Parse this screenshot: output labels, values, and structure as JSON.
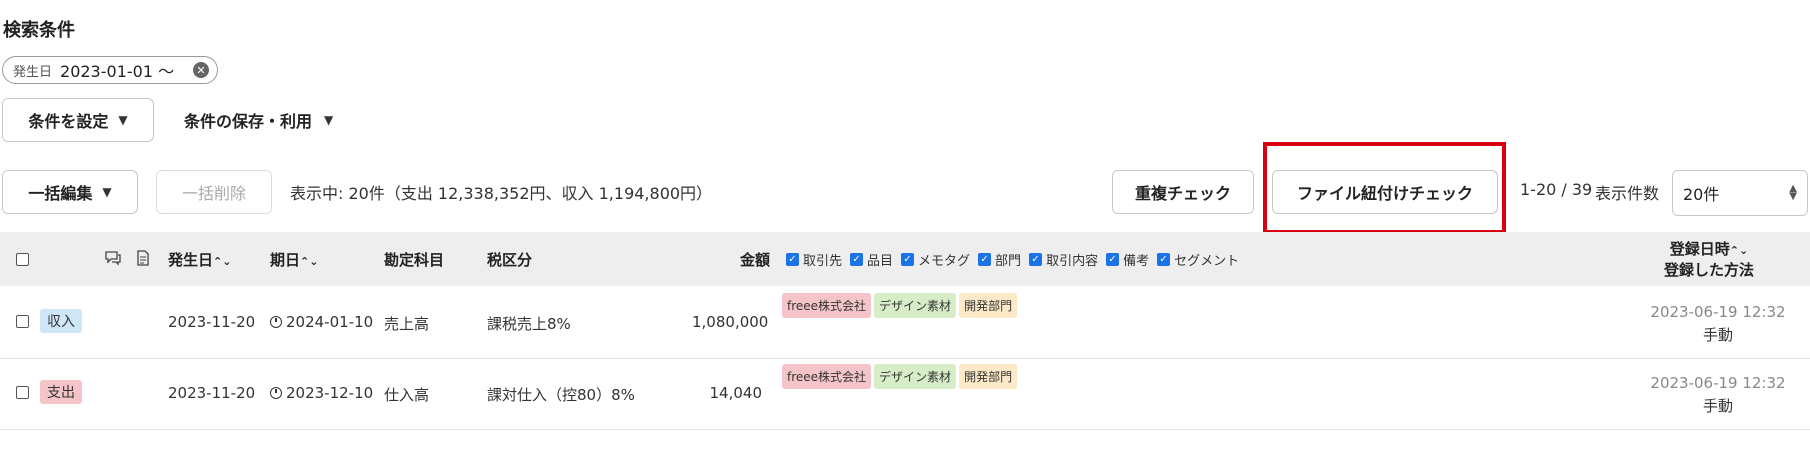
{
  "search": {
    "title": "検索条件",
    "filter_chip": {
      "label": "発生日",
      "value": "2023-01-01 〜"
    }
  },
  "controls": {
    "set_conditions": "条件を設定",
    "save_conditions": "条件の保存・利用"
  },
  "toolbar": {
    "bulk_edit": "一括編集",
    "bulk_delete": "一括削除",
    "summary": "表示中: 20件（支出 12,338,352円、収入 1,194,800円）",
    "duplicate_check": "重複チェック",
    "file_link_check": "ファイル紐付けチェック",
    "range": "1-20 / 39",
    "per_page_label": "表示件数",
    "per_page_value": "20件"
  },
  "table": {
    "headers": {
      "date": "発生日",
      "due": "期日",
      "account": "勘定科目",
      "tax": "税区分",
      "amount": "金額",
      "registered_line1": "登録日時",
      "registered_line2": "登録した方法"
    },
    "column_toggles": [
      "取引先",
      "品目",
      "メモタグ",
      "部門",
      "取引内容",
      "備考",
      "セグメント"
    ],
    "rows": [
      {
        "type": "収入",
        "date": "2023-11-20",
        "due": "2024-01-10",
        "account": "売上高",
        "tax": "課税売上8%",
        "amount": "1,080,000",
        "tags": [
          "freee株式会社",
          "デザイン素材",
          "開発部門"
        ],
        "registered_at": "2023-06-19 12:32",
        "method": "手動"
      },
      {
        "type": "支出",
        "date": "2023-11-20",
        "due": "2023-12-10",
        "account": "仕入高",
        "tax": "課対仕入（控80）8%",
        "amount": "14,040",
        "tags": [
          "freee株式会社",
          "デザイン素材",
          "開発部門"
        ],
        "registered_at": "2023-06-19 12:32",
        "method": "手動"
      }
    ]
  },
  "colors": {
    "highlight": "#d9000f",
    "income_badge": "#cfe6f6",
    "expense_badge": "#f4c4c8",
    "partner_tag": "#f4c4c8",
    "item_tag": "#d7edc7",
    "dept_tag": "#fbe9c7",
    "header_bg": "#eeeeee"
  },
  "icons": [
    "clear-icon",
    "chevron-down-icon",
    "comment-icon",
    "document-icon",
    "sort-arrows-icon",
    "clock-icon",
    "select-arrows-icon"
  ]
}
